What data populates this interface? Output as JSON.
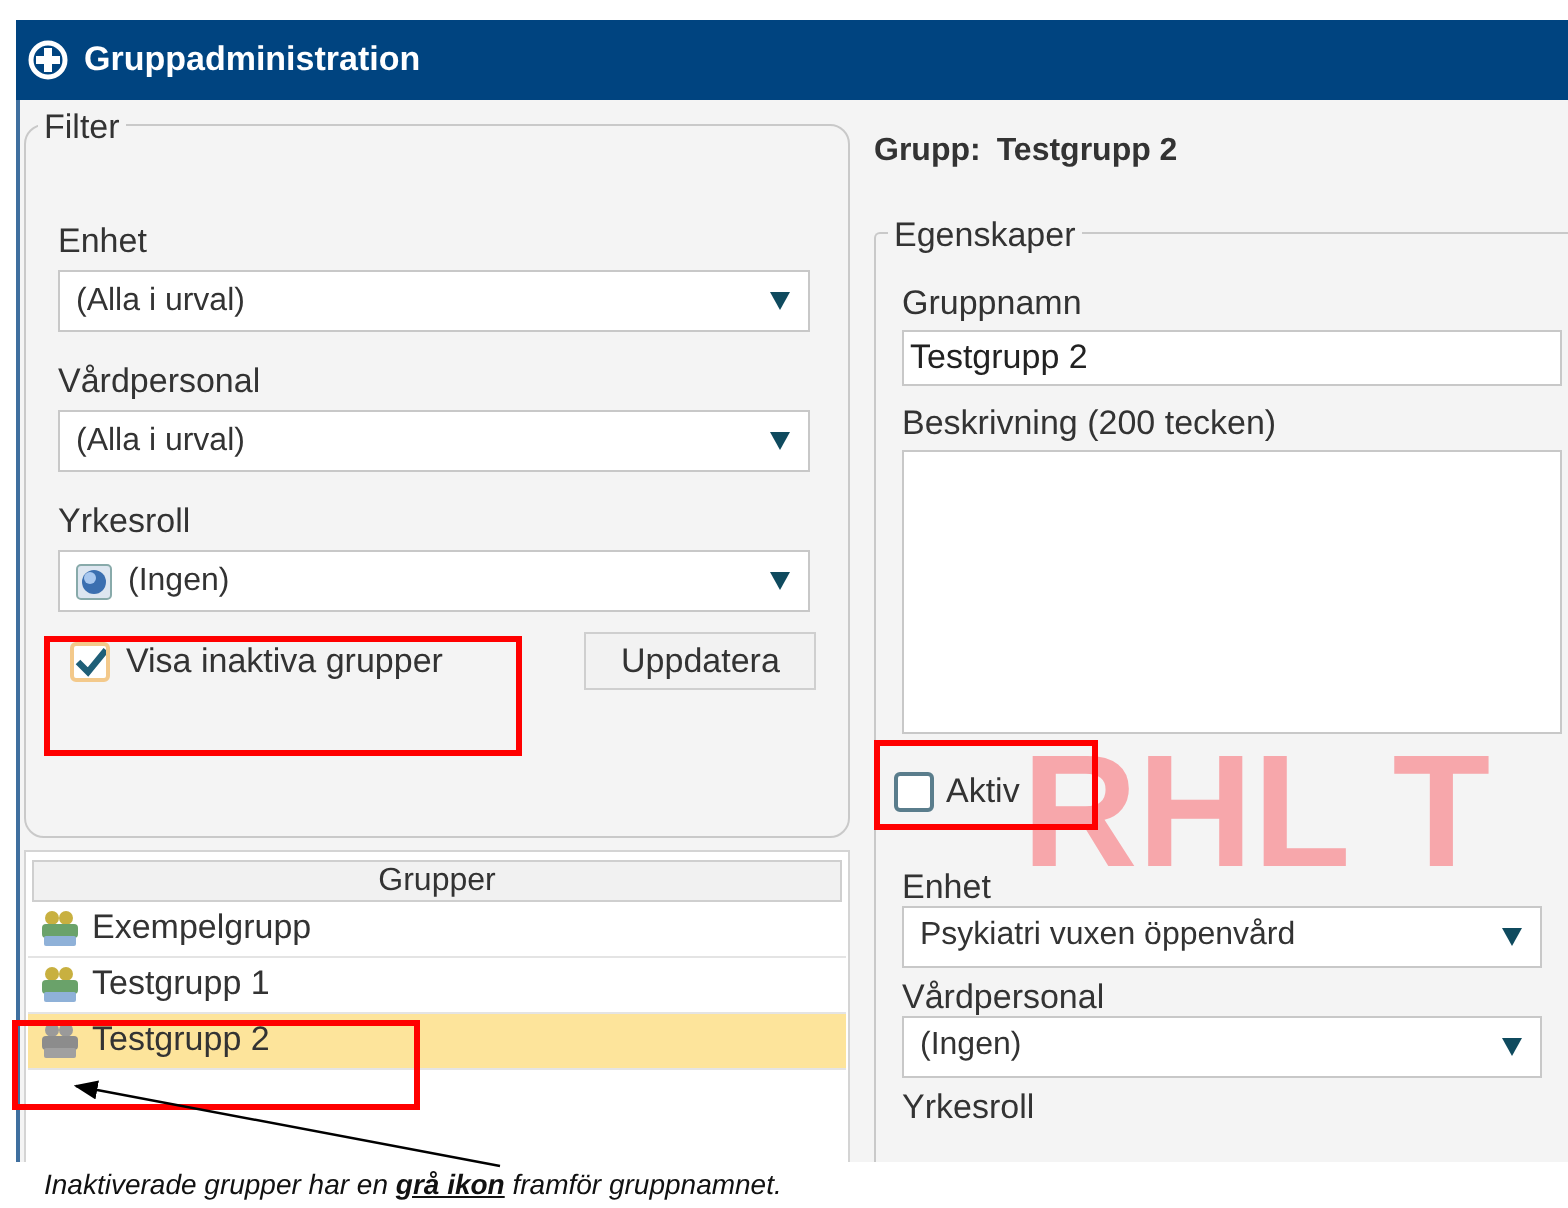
{
  "window": {
    "title": "Gruppadministration"
  },
  "filter": {
    "legend": "Filter",
    "fields": [
      {
        "label": "Enhet",
        "value": "(Alla i urval)",
        "has_icon": false
      },
      {
        "label": "Vårdpersonal",
        "value": "(Alla i urval)",
        "has_icon": false
      },
      {
        "label": "Yrkesroll",
        "value": "(Ingen)",
        "has_icon": true
      }
    ],
    "show_inactive": {
      "label": "Visa inaktiva grupper",
      "checked": true
    },
    "update_button": "Uppdatera"
  },
  "groups": {
    "header": "Grupper",
    "items": [
      {
        "name": "Exempelgrupp",
        "active": true,
        "selected": false
      },
      {
        "name": "Testgrupp 1",
        "active": true,
        "selected": false
      },
      {
        "name": "Testgrupp 2",
        "active": false,
        "selected": true
      }
    ]
  },
  "detail": {
    "heading_label": "Grupp:",
    "heading_value": "Testgrupp 2",
    "legend": "Egenskaper",
    "name_label": "Gruppnamn",
    "name_value": "Testgrupp 2",
    "description_label": "Beskrivning (200 tecken)",
    "active": {
      "label": "Aktiv",
      "checked": false
    },
    "environment_mark": "RHL T",
    "fields": [
      {
        "label": "Enhet",
        "value": "Psykiatri vuxen öppenvård"
      },
      {
        "label": "Vårdpersonal",
        "value": "(Ingen)"
      }
    ],
    "last_label": "Yrkesroll"
  },
  "caption": "Inaktiverade grupper har en **grå ikon** framför gruppnamnet."
}
